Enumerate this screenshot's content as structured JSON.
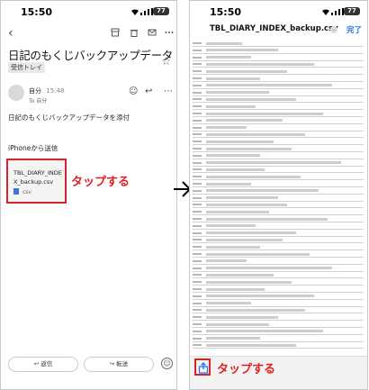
{
  "left": {
    "status_time": "15:50",
    "battery": "77",
    "subject": "日記のもくじバックアップデータ",
    "inbox_badge": "受信トレイ",
    "sender": "自分",
    "sent_time": "15:48",
    "recipient": "To 自分",
    "body_line1": "日記のもくじバックアップデータを添付",
    "body_line2": "iPhoneから送信",
    "attachment_name": "TBL_DIARY_INDEX_backup.csv",
    "attachment_type": "csv",
    "callout": "タップする",
    "reply_label": "返信",
    "forward_label": "転送"
  },
  "right": {
    "status_time": "15:50",
    "battery": "77",
    "file_title": "TBL_DIARY_INDEX_backup.csv",
    "done_label": "完了",
    "callout": "タップする"
  },
  "colors": {
    "callout_red": "#e02020",
    "accent_blue": "#1a73e8"
  },
  "icons": [
    "back-icon",
    "archive-icon",
    "trash-icon",
    "more-icon",
    "star-icon",
    "emoji-icon",
    "reply-icon",
    "forward-icon",
    "share-icon",
    "arrow-right-icon"
  ]
}
